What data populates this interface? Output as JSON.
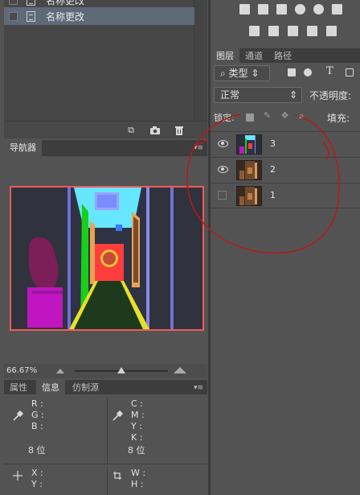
{
  "history": {
    "items": [
      {
        "label": "名称更改",
        "partial": true
      },
      {
        "label": "名称更改",
        "selected": true
      }
    ]
  },
  "navigator": {
    "tab_label": "导航器",
    "zoom": "66.67%",
    "zoom_slider_value": 0.5
  },
  "info": {
    "tabs": [
      "属性",
      "信息",
      "仿制源"
    ],
    "active_tab": "信息",
    "left_channels": [
      "R :",
      "G :",
      "B :"
    ],
    "right_channels": [
      "C :",
      "M :",
      "Y :",
      "K :"
    ],
    "left_bits": "8 位",
    "right_bits": "8 位",
    "coord_labels": [
      "X :",
      "Y :"
    ],
    "size_labels": [
      "W :",
      "H :"
    ]
  },
  "layers_panel": {
    "tabs": [
      "图层",
      "通道",
      "路径"
    ],
    "active_tab": "图层",
    "filter_kind": "类型",
    "blend_mode": "正常",
    "opacity_label": "不透明度:",
    "lock_label": "锁定:",
    "fill_label": "填充:",
    "layers": [
      {
        "name": "3",
        "visible": true
      },
      {
        "name": "2",
        "visible": true
      },
      {
        "name": "1",
        "visible": false
      }
    ]
  },
  "colors": {
    "panel_bg": "#535353",
    "selected_row": "#5e6a7a",
    "annotation_red": "#b31c1c",
    "nav_frame": "#ef5a5a"
  }
}
